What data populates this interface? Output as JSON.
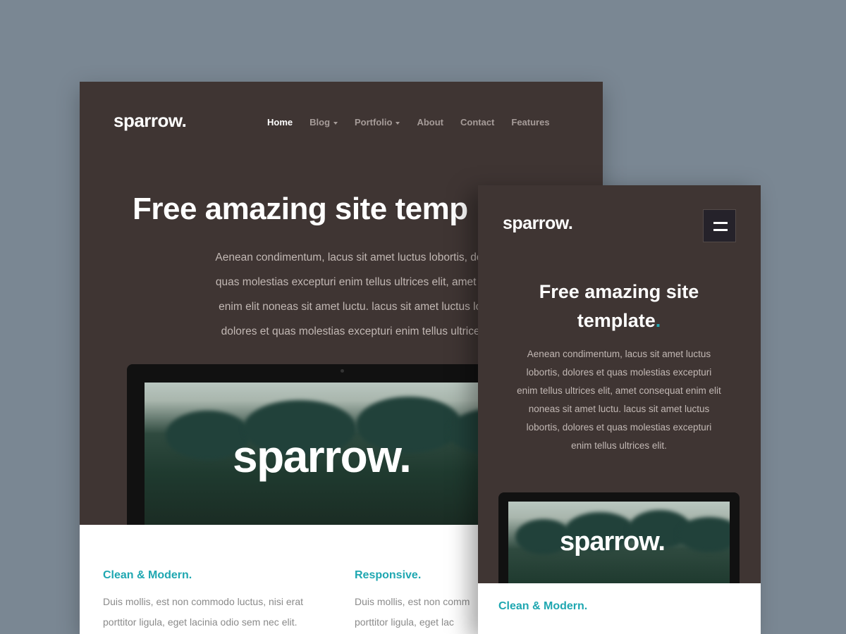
{
  "desktop": {
    "logo": "sparrow.",
    "nav": [
      {
        "label": "Home",
        "active": true,
        "dropdown": false
      },
      {
        "label": "Blog",
        "active": false,
        "dropdown": true
      },
      {
        "label": "Portfolio",
        "active": false,
        "dropdown": true
      },
      {
        "label": "About",
        "active": false,
        "dropdown": false
      },
      {
        "label": "Contact",
        "active": false,
        "dropdown": false
      },
      {
        "label": "Features",
        "active": false,
        "dropdown": false
      }
    ],
    "hero": {
      "title": "Free amazing site temp",
      "lines": [
        "Aenean condimentum, lacus sit amet luctus lobortis, dolo",
        "quas molestias excepturi enim tellus ultrices elit, amet co",
        "enim elit noneas sit amet luctu. lacus sit amet luctus lob",
        "dolores et quas molestias excepturi enim tellus ultrices"
      ]
    },
    "screen_logo": "sparrow.",
    "features": [
      {
        "title": "Clean & Modern.",
        "lines": [
          "Duis mollis, est non commodo luctus, nisi erat",
          "porttitor ligula, eget lacinia odio sem nec elit."
        ]
      },
      {
        "title": "Responsive.",
        "lines": [
          "Duis mollis, est non comm",
          "porttitor ligula, eget lac"
        ]
      }
    ]
  },
  "mobile": {
    "logo": "sparrow.",
    "menu_icon": "hamburger-icon",
    "hero": {
      "title_line1": "Free amazing site",
      "title_line2": "template",
      "title_dot": ".",
      "text": "Aenean condimentum, lacus sit amet luctus lobortis, dolores et quas molestias excepturi enim tellus ultrices elit, amet consequat enim elit noneas sit amet luctu. lacus sit amet luctus lobortis, dolores et quas molestias excepturi enim tellus ultrices elit."
    },
    "screen_logo": "sparrow.",
    "feature_title": "Clean & Modern."
  },
  "colors": {
    "background": "#7a8793",
    "panel": "#3f3533",
    "accent": "#1fa7b1",
    "nav_inactive": "#a69c99"
  }
}
